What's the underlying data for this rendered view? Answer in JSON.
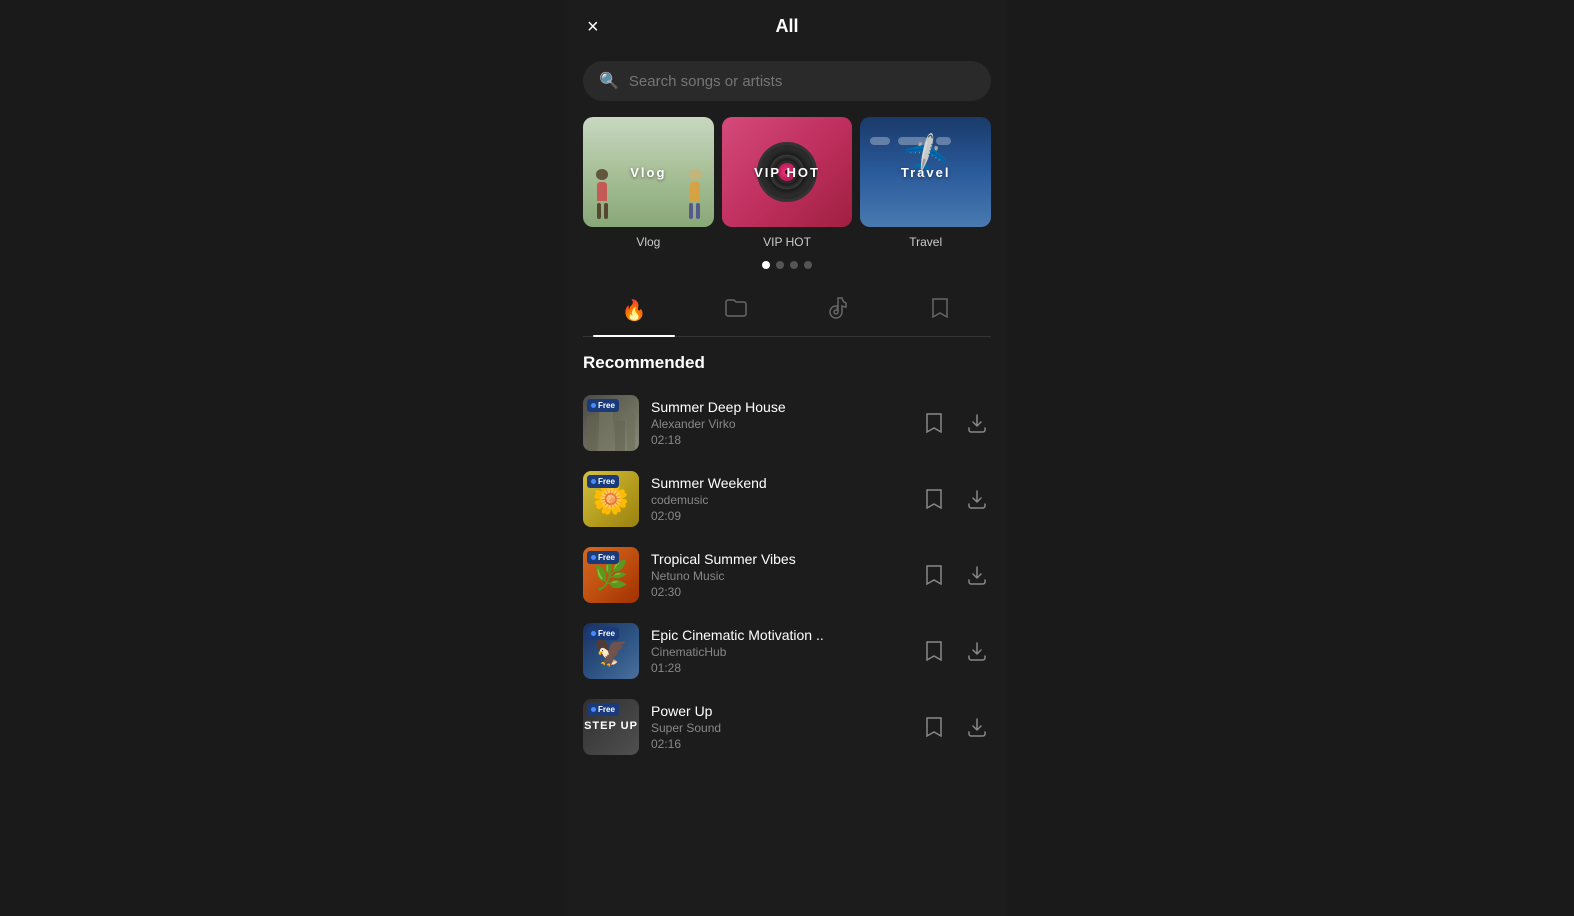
{
  "header": {
    "title": "All",
    "close_label": "×"
  },
  "search": {
    "placeholder": "Search songs or artists"
  },
  "categories": [
    {
      "id": "vlog",
      "name": "Vlog",
      "type": "vlog"
    },
    {
      "id": "viphot",
      "name": "VIP HOT",
      "type": "viphot"
    },
    {
      "id": "travel",
      "name": "Travel",
      "type": "travel"
    }
  ],
  "pagination_dots": 4,
  "tabs": [
    {
      "id": "hot",
      "icon": "🔥",
      "active": true
    },
    {
      "id": "folder",
      "icon": "📁",
      "active": false
    },
    {
      "id": "tiktok",
      "icon": "♪",
      "active": false
    },
    {
      "id": "bookmark",
      "icon": "🔖",
      "active": false
    }
  ],
  "recommended_title": "Recommended",
  "songs": [
    {
      "id": 1,
      "title": "Summer Deep House",
      "artist": "Alexander Virko",
      "duration": "02:18",
      "badge": "Free",
      "thumb_type": "summer-deep"
    },
    {
      "id": 2,
      "title": "Summer Weekend",
      "artist": "codemusic",
      "duration": "02:09",
      "badge": "Free",
      "thumb_type": "summer-weekend"
    },
    {
      "id": 3,
      "title": "Tropical Summer Vibes",
      "artist": "Netuno Music",
      "duration": "02:30",
      "badge": "Free",
      "thumb_type": "tropical"
    },
    {
      "id": 4,
      "title": "Epic Cinematic Motivation ..",
      "artist": "CinematicHub",
      "duration": "01:28",
      "badge": "Free",
      "thumb_type": "epic"
    },
    {
      "id": 5,
      "title": "Power Up",
      "artist": "Super Sound",
      "duration": "02:16",
      "badge": "Free",
      "thumb_type": "power"
    }
  ],
  "actions": {
    "bookmark_label": "Bookmark",
    "download_label": "Download"
  }
}
